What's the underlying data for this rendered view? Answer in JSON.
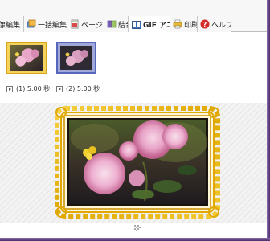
{
  "tabs": [
    {
      "label": "像編集",
      "icon": "image-edit-icon",
      "active": false
    },
    {
      "label": "一括編集",
      "icon": "batch-edit-icon",
      "active": false
    },
    {
      "label": "ページ",
      "icon": "page-icon",
      "active": false
    },
    {
      "label": "結合",
      "icon": "merge-icon",
      "active": false
    },
    {
      "label": "GIF アニメ",
      "icon": "gif-animation-icon",
      "active": true
    },
    {
      "label": "印刷",
      "icon": "print-icon",
      "active": false
    },
    {
      "label": "ヘルプ",
      "icon": "help-icon",
      "active": false
    }
  ],
  "frames": [
    {
      "caption": "(1) 5.00 秒",
      "selected": false
    },
    {
      "caption": "(2) 5.00 秒",
      "selected": true
    }
  ],
  "colors": {
    "frame_gold": "#e0a800",
    "selection_blue": "#5566bb",
    "window_border": "#5a3e80"
  }
}
